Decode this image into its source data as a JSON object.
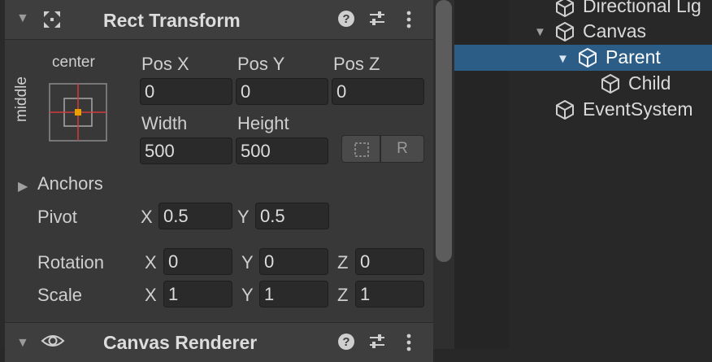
{
  "inspector": {
    "rect_transform": {
      "title": "Rect Transform",
      "anchor_preset": {
        "horizontal": "center",
        "vertical": "middle"
      },
      "pos_x_label": "Pos X",
      "pos_y_label": "Pos Y",
      "pos_z_label": "Pos Z",
      "pos_x": "0",
      "pos_y": "0",
      "pos_z": "0",
      "width_label": "Width",
      "height_label": "Height",
      "width": "500",
      "height": "500",
      "raw_edit_label": "R",
      "anchors_label": "Anchors",
      "pivot_label": "Pivot",
      "pivot": {
        "x_axis": "X",
        "x": "0.5",
        "y_axis": "Y",
        "y": "0.5"
      },
      "rotation_label": "Rotation",
      "rotation": {
        "x_axis": "X",
        "x": "0",
        "y_axis": "Y",
        "y": "0",
        "z_axis": "Z",
        "z": "0"
      },
      "scale_label": "Scale",
      "scale": {
        "x_axis": "X",
        "x": "1",
        "y_axis": "Y",
        "y": "1",
        "z_axis": "Z",
        "z": "1"
      }
    },
    "canvas_renderer": {
      "title": "Canvas Renderer"
    }
  },
  "hierarchy": {
    "items": [
      {
        "label": "Directional Lig"
      },
      {
        "label": "Canvas"
      },
      {
        "label": "Parent"
      },
      {
        "label": "Child"
      },
      {
        "label": "EventSystem"
      }
    ]
  },
  "colors": {
    "selection": "#2c5d87",
    "panel": "#383838",
    "field": "#2a2a2a",
    "accent_anchor": "#e8a000",
    "anchor_lines": "#d13c3c"
  }
}
